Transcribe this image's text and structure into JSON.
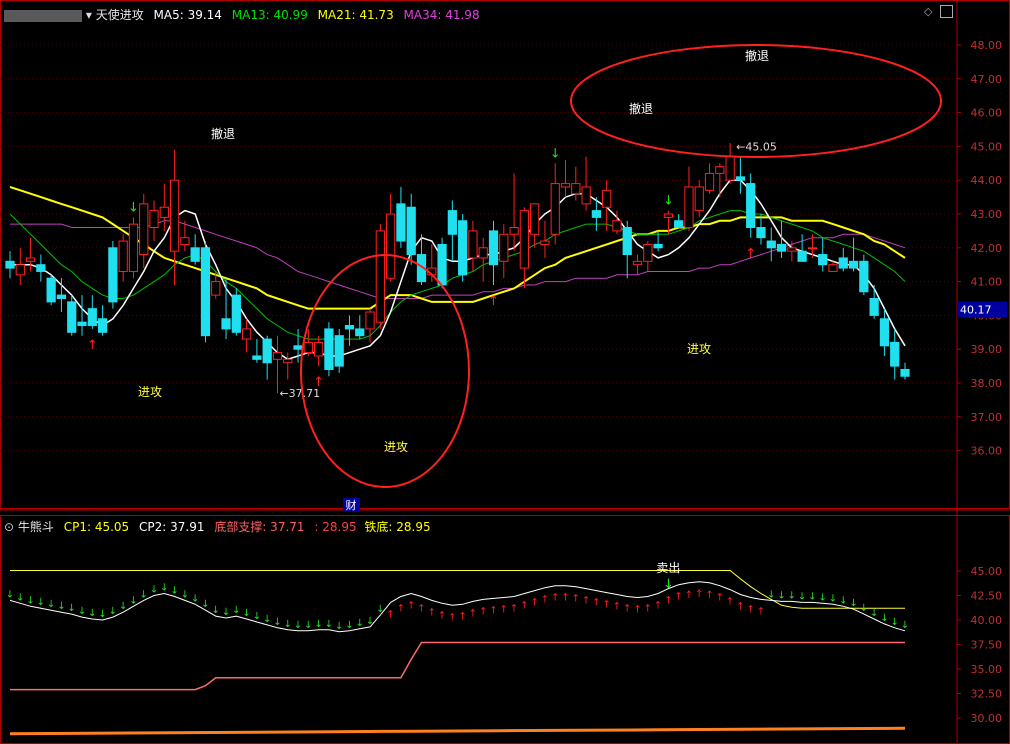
{
  "main_panel": {
    "indicator_name": "天使进攻",
    "ma": [
      {
        "label": "MA5: 39.14",
        "color": "#ffffff"
      },
      {
        "label": "MA13: 40.99",
        "color": "#00e000"
      },
      {
        "label": "MA21: 41.73",
        "color": "#ffff00"
      },
      {
        "label": "MA34: 41.98",
        "color": "#e040e0"
      }
    ],
    "y_ticks": [
      "48.00",
      "47.00",
      "46.00",
      "45.00",
      "44.00",
      "43.00",
      "42.00",
      "41.00",
      "40.00",
      "39.00",
      "38.00",
      "37.00",
      "36.00"
    ],
    "current_price_tag": "40.17",
    "high_label": "45.05",
    "low_label": "37.71",
    "annotations": {
      "attack": "进攻",
      "retreat": "撤退",
      "finance_marker": "财"
    }
  },
  "sub_panel": {
    "indicator_name": "牛熊斗",
    "cp1": "CP1: 45.05",
    "cp2": "CP2: 37.91",
    "bottom_support": "底部支撑: 37.71",
    "mid_value": ": 28.95",
    "iron_bottom": "铁底: 28.95",
    "sell_label": "卖出",
    "y_ticks": [
      "45.00",
      "42.50",
      "40.00",
      "37.50",
      "35.00",
      "32.50",
      "30.00"
    ]
  },
  "chart_data": [
    {
      "type": "candlestick",
      "title": "天使进攻",
      "y_range": [
        35.5,
        48.6
      ],
      "candles": [
        [
          41.6,
          41.9,
          41.1,
          41.4
        ],
        [
          41.2,
          42.0,
          40.9,
          41.5
        ],
        [
          41.6,
          42.3,
          41.3,
          41.7
        ],
        [
          41.5,
          41.8,
          41.0,
          41.3
        ],
        [
          41.1,
          41.2,
          40.3,
          40.4
        ],
        [
          40.6,
          41.1,
          40.1,
          40.5
        ],
        [
          40.4,
          40.6,
          39.4,
          39.5
        ],
        [
          39.8,
          40.6,
          39.4,
          39.7
        ],
        [
          40.2,
          40.6,
          39.6,
          39.7
        ],
        [
          39.9,
          40.3,
          39.4,
          39.5
        ],
        [
          42.0,
          42.2,
          40.2,
          40.4
        ],
        [
          41.3,
          42.4,
          41.0,
          42.2
        ],
        [
          41.3,
          42.9,
          41.1,
          42.7
        ],
        [
          41.8,
          43.6,
          41.4,
          43.3
        ],
        [
          42.6,
          43.4,
          42.2,
          43.1
        ],
        [
          42.9,
          43.9,
          42.5,
          43.2
        ],
        [
          41.9,
          44.9,
          40.9,
          44.0
        ],
        [
          42.1,
          42.8,
          41.9,
          42.3
        ],
        [
          42.0,
          42.4,
          41.5,
          41.6
        ],
        [
          42.0,
          42.2,
          39.2,
          39.4
        ],
        [
          40.6,
          41.3,
          40.5,
          41.0
        ],
        [
          39.9,
          41.1,
          39.3,
          39.6
        ],
        [
          40.6,
          40.8,
          39.4,
          39.5
        ],
        [
          39.3,
          39.9,
          38.9,
          39.6
        ],
        [
          38.8,
          39.3,
          38.6,
          38.7
        ],
        [
          39.3,
          39.4,
          38.1,
          38.6
        ],
        [
          38.7,
          39.4,
          37.7,
          38.9
        ],
        [
          38.6,
          38.9,
          38.1,
          38.7
        ],
        [
          39.1,
          39.6,
          38.6,
          39.0
        ],
        [
          38.9,
          39.6,
          38.8,
          39.2
        ],
        [
          38.8,
          39.4,
          38.5,
          39.2
        ],
        [
          39.6,
          39.8,
          38.2,
          38.4
        ],
        [
          39.4,
          39.6,
          38.3,
          38.5
        ],
        [
          39.7,
          40.0,
          39.1,
          39.6
        ],
        [
          39.6,
          40.0,
          39.3,
          39.4
        ],
        [
          39.6,
          40.2,
          39.2,
          40.1
        ],
        [
          39.8,
          42.7,
          39.6,
          42.5
        ],
        [
          41.1,
          43.6,
          41.0,
          43.0
        ],
        [
          43.3,
          43.8,
          42.0,
          42.2
        ],
        [
          43.2,
          43.6,
          41.5,
          41.8
        ],
        [
          41.8,
          42.4,
          40.9,
          41.0
        ],
        [
          41.2,
          42.1,
          41.0,
          41.4
        ],
        [
          42.1,
          42.3,
          40.8,
          40.9
        ],
        [
          43.1,
          43.4,
          41.6,
          42.4
        ],
        [
          42.8,
          43.0,
          41.0,
          41.2
        ],
        [
          41.7,
          42.8,
          41.3,
          42.5
        ],
        [
          41.7,
          42.3,
          41.0,
          42.0
        ],
        [
          42.5,
          42.8,
          40.9,
          41.5
        ],
        [
          41.6,
          42.7,
          41.1,
          42.4
        ],
        [
          42.4,
          44.2,
          41.9,
          42.6
        ],
        [
          41.4,
          43.2,
          40.8,
          43.1
        ],
        [
          42.4,
          43.3,
          42.0,
          43.3
        ],
        [
          42.1,
          42.8,
          41.7,
          42.2
        ],
        [
          42.4,
          44.5,
          42.1,
          43.9
        ],
        [
          43.8,
          44.6,
          43.5,
          43.9
        ],
        [
          43.6,
          44.4,
          43.4,
          43.9
        ],
        [
          43.3,
          44.7,
          43.1,
          43.8
        ],
        [
          43.1,
          43.5,
          42.5,
          42.9
        ],
        [
          43.2,
          44.0,
          42.5,
          43.7
        ],
        [
          42.5,
          43.1,
          42.4,
          42.8
        ],
        [
          42.6,
          42.8,
          41.1,
          41.8
        ],
        [
          41.5,
          41.8,
          41.2,
          41.6
        ],
        [
          41.6,
          42.2,
          41.3,
          42.1
        ],
        [
          42.1,
          42.5,
          41.9,
          42.0
        ],
        [
          42.9,
          43.1,
          42.4,
          43.0
        ],
        [
          42.8,
          43.0,
          42.6,
          42.6
        ],
        [
          42.6,
          44.4,
          42.5,
          43.8
        ],
        [
          43.1,
          44.0,
          42.9,
          43.8
        ],
        [
          43.7,
          44.5,
          43.6,
          44.2
        ],
        [
          44.2,
          44.5,
          43.5,
          44.4
        ],
        [
          44.0,
          45.1,
          43.9,
          44.7
        ],
        [
          44.1,
          44.7,
          43.6,
          44.0
        ],
        [
          43.9,
          44.2,
          42.3,
          42.6
        ],
        [
          42.6,
          43.0,
          42.1,
          42.3
        ],
        [
          42.2,
          42.6,
          41.6,
          42.0
        ],
        [
          42.1,
          42.8,
          41.7,
          41.9
        ],
        [
          41.9,
          42.2,
          41.6,
          42.0
        ],
        [
          41.9,
          42.4,
          41.6,
          41.6
        ],
        [
          42.0,
          42.4,
          41.7,
          42.0
        ],
        [
          41.8,
          42.3,
          41.3,
          41.5
        ],
        [
          41.3,
          41.6,
          41.4,
          41.5
        ],
        [
          41.7,
          42.0,
          41.3,
          41.4
        ],
        [
          41.6,
          42.3,
          41.3,
          41.4
        ],
        [
          41.6,
          41.8,
          40.6,
          40.7
        ],
        [
          40.5,
          40.9,
          39.9,
          40.0
        ],
        [
          39.9,
          40.2,
          38.8,
          39.1
        ],
        [
          39.2,
          39.6,
          38.1,
          38.5
        ],
        [
          38.4,
          38.6,
          38.1,
          38.2
        ]
      ],
      "ma5": [
        41.5,
        41.5,
        41.5,
        41.4,
        41.2,
        40.9,
        40.6,
        40.2,
        39.9,
        39.7,
        39.9,
        40.3,
        40.8,
        41.3,
        41.9,
        42.3,
        42.9,
        43.1,
        43.0,
        42.1,
        41.5,
        40.8,
        40.4,
        39.9,
        39.5,
        39.2,
        38.9,
        38.7,
        38.8,
        38.9,
        38.9,
        38.8,
        38.8,
        38.9,
        39.0,
        39.1,
        39.4,
        40.1,
        41.0,
        41.9,
        42.3,
        42.2,
        41.7,
        41.6,
        41.6,
        41.7,
        41.8,
        41.8,
        41.9,
        42.0,
        42.3,
        42.7,
        43.0,
        43.2,
        43.5,
        43.6,
        43.6,
        43.4,
        43.2,
        42.9,
        42.5,
        42.1,
        41.9,
        41.7,
        41.8,
        42.0,
        42.3,
        42.7,
        43.1,
        43.6,
        44.0,
        44.0,
        43.7,
        43.3,
        42.8,
        42.3,
        42.0,
        41.9,
        41.8,
        41.7,
        41.6,
        41.5,
        41.5,
        41.2,
        40.8,
        40.2,
        39.6,
        39.1
      ],
      "ma13": [
        43.0,
        42.7,
        42.4,
        42.1,
        41.8,
        41.5,
        41.3,
        41.0,
        40.8,
        40.6,
        40.5,
        40.5,
        40.6,
        40.8,
        41.0,
        41.2,
        41.5,
        41.7,
        41.8,
        41.6,
        41.3,
        41.0,
        40.8,
        40.5,
        40.2,
        39.9,
        39.7,
        39.5,
        39.4,
        39.3,
        39.3,
        39.3,
        39.3,
        39.3,
        39.3,
        39.4,
        39.7,
        40.1,
        40.4,
        40.6,
        40.7,
        40.8,
        40.9,
        41.1,
        41.2,
        41.3,
        41.5,
        41.6,
        41.7,
        41.8,
        41.9,
        42.1,
        42.2,
        42.4,
        42.5,
        42.6,
        42.7,
        42.7,
        42.7,
        42.6,
        42.5,
        42.4,
        42.4,
        42.4,
        42.4,
        42.5,
        42.6,
        42.8,
        42.9,
        43.0,
        43.1,
        43.1,
        43.0,
        43.0,
        42.9,
        42.8,
        42.7,
        42.6,
        42.5,
        42.3,
        42.2,
        42.1,
        42.0,
        41.9,
        41.7,
        41.5,
        41.3,
        41.0
      ],
      "ma21": [
        43.8,
        43.7,
        43.6,
        43.5,
        43.4,
        43.3,
        43.2,
        43.1,
        43.0,
        42.9,
        42.7,
        42.5,
        42.3,
        42.1,
        41.9,
        41.7,
        41.6,
        41.5,
        41.4,
        41.3,
        41.2,
        41.1,
        41.0,
        40.9,
        40.8,
        40.6,
        40.5,
        40.4,
        40.3,
        40.2,
        40.2,
        40.2,
        40.2,
        40.2,
        40.2,
        40.2,
        40.4,
        40.6,
        40.6,
        40.6,
        40.5,
        40.4,
        40.4,
        40.4,
        40.4,
        40.4,
        40.5,
        40.6,
        40.7,
        40.8,
        41.0,
        41.2,
        41.4,
        41.5,
        41.7,
        41.8,
        41.9,
        42.0,
        42.1,
        42.2,
        42.3,
        42.4,
        42.4,
        42.5,
        42.5,
        42.6,
        42.6,
        42.7,
        42.7,
        42.8,
        42.8,
        42.9,
        42.9,
        42.9,
        42.9,
        42.9,
        42.8,
        42.8,
        42.8,
        42.8,
        42.7,
        42.6,
        42.5,
        42.4,
        42.2,
        42.1,
        41.9,
        41.7
      ],
      "ma34": [
        42.7,
        42.7,
        42.7,
        42.7,
        42.7,
        42.7,
        42.6,
        42.6,
        42.6,
        42.6,
        42.6,
        42.6,
        42.6,
        42.6,
        42.7,
        42.8,
        42.8,
        42.7,
        42.6,
        42.5,
        42.4,
        42.3,
        42.2,
        42.1,
        42.0,
        41.8,
        41.7,
        41.5,
        41.3,
        41.2,
        41.1,
        41.0,
        40.9,
        40.8,
        40.7,
        40.6,
        40.5,
        40.5,
        40.5,
        40.5,
        40.5,
        40.6,
        40.6,
        40.6,
        40.6,
        40.6,
        40.7,
        40.7,
        40.8,
        40.8,
        40.9,
        40.9,
        41.0,
        41.0,
        41.0,
        41.1,
        41.1,
        41.1,
        41.1,
        41.2,
        41.2,
        41.2,
        41.3,
        41.3,
        41.3,
        41.3,
        41.3,
        41.4,
        41.4,
        41.5,
        41.5,
        41.6,
        41.7,
        41.8,
        41.9,
        42.0,
        42.1,
        42.2,
        42.3,
        42.3,
        42.3,
        42.4,
        42.4,
        42.4,
        42.3,
        42.2,
        42.1,
        42.0
      ],
      "up_arrows": [
        8,
        30,
        47,
        72
      ],
      "down_arrows": [
        12,
        53,
        64
      ]
    },
    {
      "type": "line",
      "title": "牛熊斗",
      "y_range": [
        28.5,
        46.7
      ],
      "cp1": [
        45.05,
        45.05,
        45.05,
        45.05,
        45.05,
        45.05,
        45.05,
        45.05,
        45.05,
        45.05,
        45.05,
        45.05,
        45.05,
        45.05,
        45.05,
        45.05,
        45.05,
        45.05,
        45.05,
        45.05,
        45.05,
        45.05,
        45.05,
        45.05,
        45.05,
        45.05,
        45.05,
        45.05,
        45.05,
        45.05,
        45.05,
        45.05,
        45.05,
        45.05,
        45.05,
        45.05,
        45.05,
        45.05,
        45.05,
        45.05,
        45.05,
        45.05,
        45.05,
        45.05,
        45.05,
        45.05,
        45.05,
        45.05,
        45.05,
        45.05,
        45.05,
        45.05,
        45.05,
        45.05,
        45.05,
        45.05,
        45.05,
        45.05,
        45.05,
        45.05,
        45.05,
        45.05,
        45.05,
        45.05,
        45.05,
        45.05,
        45.05,
        45.05,
        45.05,
        45.05,
        45.05,
        44.2,
        43.4,
        42.7,
        42.1,
        41.5,
        41.3,
        41.2,
        41.2,
        41.2,
        41.2,
        41.2,
        41.2,
        41.2,
        41.2,
        41.2,
        41.2,
        41.2
      ],
      "cp2": [
        42.0,
        41.7,
        41.4,
        41.2,
        41.0,
        40.8,
        40.6,
        40.3,
        40.1,
        40.0,
        40.3,
        40.8,
        41.4,
        42.0,
        42.5,
        42.7,
        42.4,
        42.0,
        41.6,
        41.0,
        40.4,
        40.2,
        40.4,
        40.1,
        39.8,
        39.5,
        39.2,
        39.0,
        38.9,
        38.9,
        39.0,
        39.0,
        38.8,
        38.9,
        39.1,
        39.3,
        40.5,
        41.8,
        42.4,
        42.7,
        42.4,
        42.0,
        41.7,
        41.5,
        41.6,
        41.9,
        42.1,
        42.2,
        42.3,
        42.4,
        42.7,
        43.0,
        43.3,
        43.5,
        43.5,
        43.4,
        43.2,
        43.0,
        42.8,
        42.6,
        42.4,
        42.3,
        42.4,
        42.7,
        43.2,
        43.6,
        43.8,
        43.9,
        43.8,
        43.5,
        43.1,
        42.6,
        42.3,
        42.1,
        42.0,
        41.9,
        41.9,
        41.8,
        41.8,
        41.7,
        41.6,
        41.4,
        41.1,
        40.6,
        40.1,
        39.6,
        39.2,
        38.9
      ],
      "support": [
        32.9,
        32.9,
        32.9,
        32.9,
        32.9,
        32.9,
        32.9,
        32.9,
        32.9,
        32.9,
        32.9,
        32.9,
        32.9,
        32.9,
        32.9,
        32.9,
        32.9,
        32.9,
        32.9,
        33.3,
        34.1,
        34.1,
        34.1,
        34.1,
        34.1,
        34.1,
        34.1,
        34.1,
        34.1,
        34.1,
        34.1,
        34.1,
        34.1,
        34.1,
        34.1,
        34.1,
        34.1,
        34.1,
        34.1,
        36.0,
        37.7,
        37.7,
        37.7,
        37.7,
        37.7,
        37.7,
        37.7,
        37.7,
        37.7,
        37.7,
        37.7,
        37.7,
        37.7,
        37.7,
        37.7,
        37.7,
        37.7,
        37.7,
        37.7,
        37.7,
        37.7,
        37.7,
        37.7,
        37.7,
        37.7,
        37.7,
        37.7,
        37.7,
        37.7,
        37.7,
        37.7,
        37.7,
        37.7,
        37.7,
        37.7,
        37.7,
        37.7,
        37.7,
        37.7,
        37.7,
        37.7,
        37.7,
        37.7,
        37.7,
        37.7,
        37.7,
        37.7,
        37.7
      ],
      "iron_bottom": [
        28.4,
        28.45,
        28.5,
        28.55,
        28.6,
        28.65,
        28.7,
        28.75,
        28.8,
        28.85,
        28.9,
        28.95
      ],
      "sell_index": 64
    }
  ]
}
